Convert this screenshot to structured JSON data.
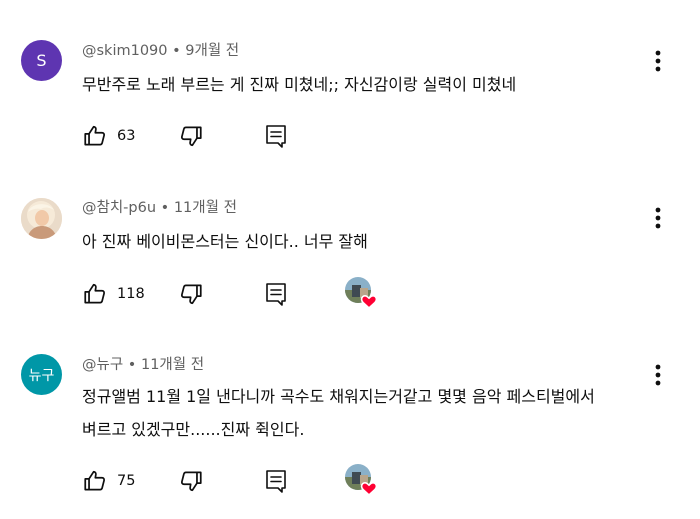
{
  "comments": [
    {
      "author": "@skim1090",
      "age": "9개월 전",
      "avatar_letter": "S",
      "avatar_color": "#5e35b1",
      "lines": [
        "무반주로 노래 부르는 게 진짜 미쳤네;; 자신감이랑 실력이 미쳤네"
      ],
      "likes": "63",
      "hearted": false
    },
    {
      "author": "@참치-p6u",
      "age": "11개월 전",
      "avatar_letter": "",
      "lines": [
        "아 진짜 베이비몬스터는 신이다.. 너무 잘해"
      ],
      "likes": "118",
      "hearted": true
    },
    {
      "author": "@뉴구",
      "age": "11개월 전",
      "avatar_letter": "뉴구",
      "avatar_color": "#0097a7",
      "lines": [
        "정규앨범 11월 1일 낸다니까 곡수도 채워지는거같고 몇몇 음악 페스티벌에서",
        "벼르고 있겠구만......진짜 쥑인다."
      ],
      "likes": "75",
      "hearted": true
    }
  ],
  "meta_separator": " • ",
  "colors": {
    "text": "#0f0f0f",
    "secondary": "#606060",
    "heart": "#ff0033"
  }
}
